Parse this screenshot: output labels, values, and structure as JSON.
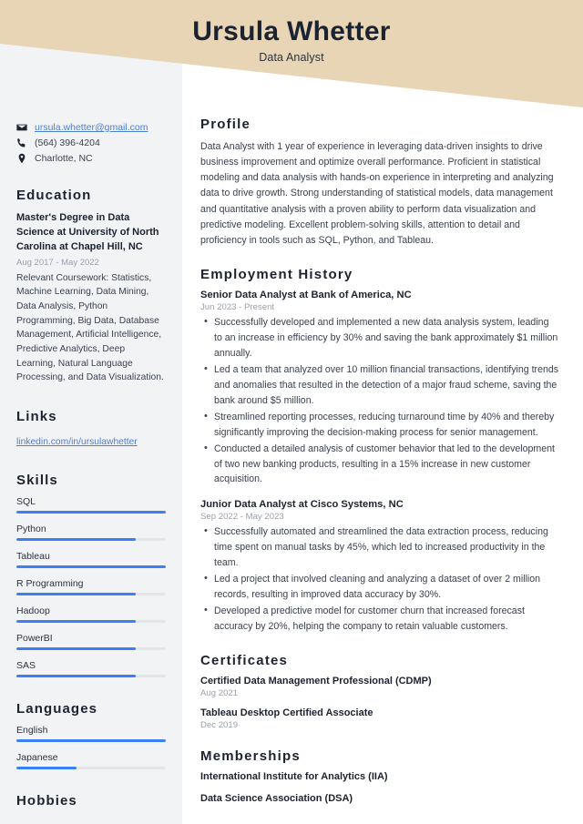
{
  "theme": {
    "band_color": "#e8d5b5",
    "sidebar_color": "#f2f3f5",
    "accent_bar": "#3b7ff5",
    "link_color": "#4a7fd4",
    "heading_color": "#1c2330",
    "muted_color": "#9aa0aa"
  },
  "header": {
    "name": "Ursula Whetter",
    "job_title": "Data Analyst"
  },
  "sidebar": {
    "contact": {
      "email": "ursula.whetter@gmail.com",
      "phone": "(564) 396-4204",
      "location": "Charlotte, NC"
    },
    "education": {
      "heading": "Education",
      "entries": [
        {
          "degree": "Master's Degree in Data Science at University of North Carolina at Chapel Hill, NC",
          "date": "Aug 2017 - May 2022",
          "description": "Relevant Coursework: Statistics, Machine Learning, Data Mining, Data Analysis, Python Programming, Big Data, Database Management, Artificial Intelligence, Predictive Analytics, Deep Learning, Natural Language Processing, and Data Visualization."
        }
      ]
    },
    "links": {
      "heading": "Links",
      "items": [
        {
          "label": "linkedin.com/in/ursulawhetter"
        }
      ]
    },
    "skills": {
      "heading": "Skills",
      "items": [
        {
          "label": "SQL",
          "level": 100
        },
        {
          "label": "Python",
          "level": 80
        },
        {
          "label": "Tableau",
          "level": 100
        },
        {
          "label": "R Programming",
          "level": 80
        },
        {
          "label": "Hadoop",
          "level": 80
        },
        {
          "label": "PowerBI",
          "level": 80
        },
        {
          "label": "SAS",
          "level": 80
        }
      ]
    },
    "languages": {
      "heading": "Languages",
      "items": [
        {
          "label": "English",
          "level": 100
        },
        {
          "label": "Japanese",
          "level": 40
        }
      ]
    },
    "hobbies": {
      "heading": "Hobbies"
    }
  },
  "main": {
    "profile": {
      "heading": "Profile",
      "text": "Data Analyst with 1 year of experience in leveraging data-driven insights to drive business improvement and optimize overall performance. Proficient in statistical modeling and data analysis with hands-on experience in interpreting and analyzing data to drive growth. Strong understanding of statistical models, data management and quantitative analysis with a proven ability to perform data visualization and predictive modeling. Excellent problem-solving skills, attention to detail and proficiency in tools such as SQL, Python, and Tableau."
    },
    "employment": {
      "heading": "Employment History",
      "jobs": [
        {
          "title": "Senior Data Analyst at Bank of America, NC",
          "date": "Jun 2023 - Present",
          "bullets": [
            "Successfully developed and implemented a new data analysis system, leading to an increase in efficiency by 30% and saving the bank approximately $1 million annually.",
            "Led a team that analyzed over 10 million financial transactions, identifying trends and anomalies that resulted in the detection of a major fraud scheme, saving the bank around $5 million.",
            "Streamlined reporting processes, reducing turnaround time by 40% and thereby significantly improving the decision-making process for senior management.",
            "Conducted a detailed analysis of customer behavior that led to the development of two new banking products, resulting in a 15% increase in new customer acquisition."
          ]
        },
        {
          "title": "Junior Data Analyst at Cisco Systems, NC",
          "date": "Sep 2022 - May 2023",
          "bullets": [
            "Successfully automated and streamlined the data extraction process, reducing time spent on manual tasks by 45%, which led to increased productivity in the team.",
            "Led a project that involved cleaning and analyzing a dataset of over 2 million records, resulting in improved data accuracy by 30%.",
            "Developed a predictive model for customer churn that increased forecast accuracy by 20%, helping the company to retain valuable customers."
          ]
        }
      ]
    },
    "certificates": {
      "heading": "Certificates",
      "items": [
        {
          "title": "Certified Data Management Professional (CDMP)",
          "date": "Aug 2021"
        },
        {
          "title": "Tableau Desktop Certified Associate",
          "date": "Dec 2019"
        }
      ]
    },
    "memberships": {
      "heading": "Memberships",
      "items": [
        {
          "title": "International Institute for Analytics (IIA)"
        },
        {
          "title": "Data Science Association (DSA)"
        }
      ]
    }
  }
}
